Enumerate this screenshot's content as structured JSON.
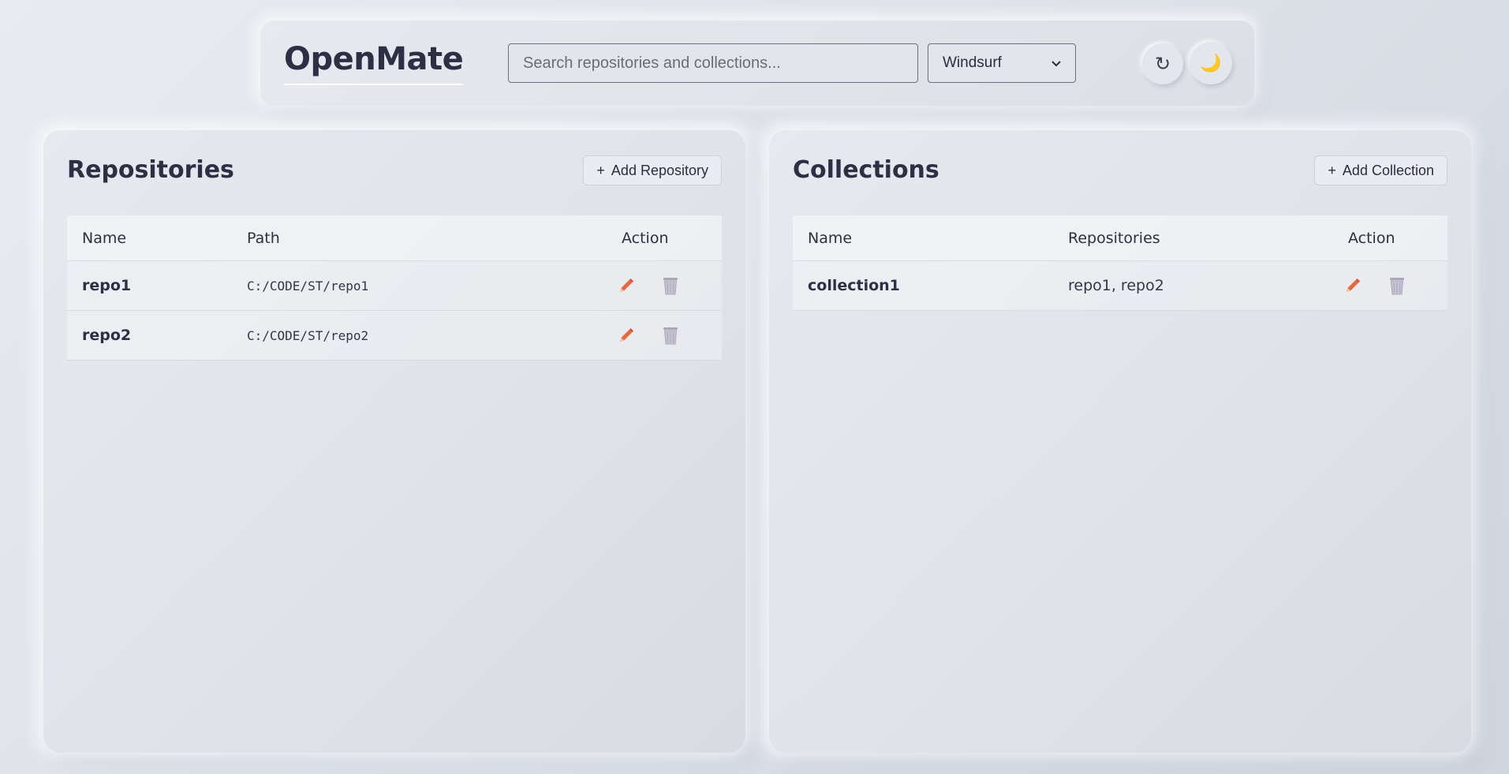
{
  "app": {
    "title": "OpenMate"
  },
  "header": {
    "search_placeholder": "Search repositories and collections...",
    "search_value": "",
    "editor_select": {
      "selected": "Windsurf"
    },
    "refresh_icon": "refresh-icon",
    "theme_icon": "moon-icon",
    "refresh_glyph": "↻",
    "theme_glyph": "🌙"
  },
  "repositories": {
    "title": "Repositories",
    "add_label": "Add Repository",
    "add_icon": "plus-icon",
    "columns": [
      "Name",
      "Path",
      "Action"
    ],
    "rows": [
      {
        "name": "repo1",
        "path": "C:/CODE/ST/repo1"
      },
      {
        "name": "repo2",
        "path": "C:/CODE/ST/repo2"
      }
    ]
  },
  "collections": {
    "title": "Collections",
    "add_label": "Add Collection",
    "add_icon": "plus-icon",
    "columns": [
      "Name",
      "Repositories",
      "Action"
    ],
    "rows": [
      {
        "name": "collection1",
        "repositories": "repo1, repo2"
      }
    ]
  },
  "colors": {
    "edit_icon": "#e8683c",
    "delete_icon": "#a9a7b8",
    "theme_moon": "#e6a23a"
  }
}
